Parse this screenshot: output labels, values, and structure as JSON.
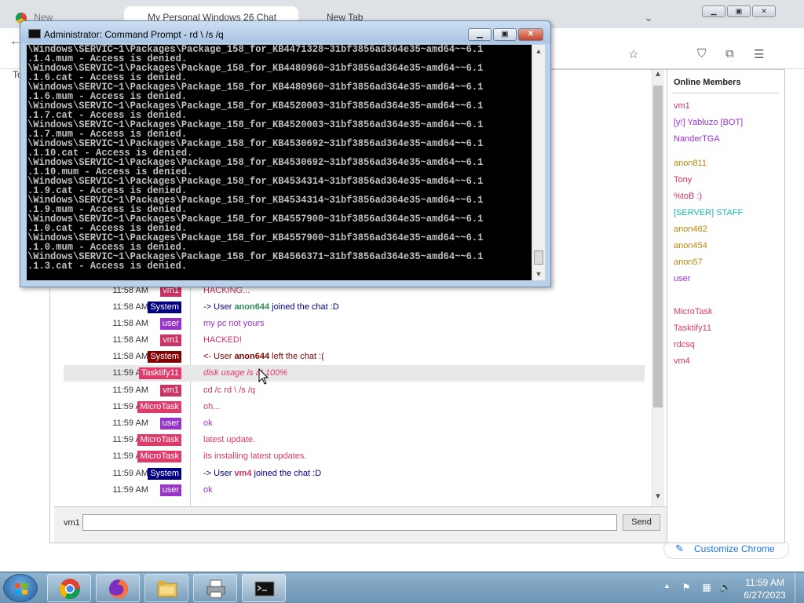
{
  "chrome": {
    "tabs": [
      {
        "label": "New"
      },
      {
        "label": "My Personal Windows 26 Chat"
      },
      {
        "label": "New Tab"
      }
    ],
    "bookmark_stub": "To",
    "customize_label": "Customize Chrome",
    "icons": [
      "chrome-icon",
      "bookmark-star-icon",
      "pocket-icon",
      "extensions-icon",
      "menu-icon",
      "back-icon"
    ]
  },
  "cmd": {
    "title": "Administrator:  Command Prompt - rd \\ /s /q",
    "lines": [
      "\\Windows\\SERVIC~1\\Packages\\Package_158_for_KB4471328~31bf3856ad364e35~amd64~~6.1",
      ".1.4.mum - Access is denied.",
      "\\Windows\\SERVIC~1\\Packages\\Package_158_for_KB4480960~31bf3856ad364e35~amd64~~6.1",
      ".1.6.cat - Access is denied.",
      "\\Windows\\SERVIC~1\\Packages\\Package_158_for_KB4480960~31bf3856ad364e35~amd64~~6.1",
      ".1.6.mum - Access is denied.",
      "\\Windows\\SERVIC~1\\Packages\\Package_158_for_KB4520003~31bf3856ad364e35~amd64~~6.1",
      ".1.7.cat - Access is denied.",
      "\\Windows\\SERVIC~1\\Packages\\Package_158_for_KB4520003~31bf3856ad364e35~amd64~~6.1",
      ".1.7.mum - Access is denied.",
      "\\Windows\\SERVIC~1\\Packages\\Package_158_for_KB4530692~31bf3856ad364e35~amd64~~6.1",
      ".1.10.cat - Access is denied.",
      "\\Windows\\SERVIC~1\\Packages\\Package_158_for_KB4530692~31bf3856ad364e35~amd64~~6.1",
      ".1.10.mum - Access is denied.",
      "\\Windows\\SERVIC~1\\Packages\\Package_158_for_KB4534314~31bf3856ad364e35~amd64~~6.1",
      ".1.9.cat - Access is denied.",
      "\\Windows\\SERVIC~1\\Packages\\Package_158_for_KB4534314~31bf3856ad364e35~amd64~~6.1",
      ".1.9.mum - Access is denied.",
      "\\Windows\\SERVIC~1\\Packages\\Package_158_for_KB4557900~31bf3856ad364e35~amd64~~6.1",
      ".1.0.cat - Access is denied.",
      "\\Windows\\SERVIC~1\\Packages\\Package_158_for_KB4557900~31bf3856ad364e35~amd64~~6.1",
      ".1.0.mum - Access is denied.",
      "\\Windows\\SERVIC~1\\Packages\\Package_158_for_KB4566371~31bf3856ad364e35~amd64~~6.1",
      ".1.3.cat - Access is denied."
    ]
  },
  "chat": {
    "messages": [
      {
        "time": "11:58 AM",
        "user": "vm1",
        "user_color": "#cc3366",
        "text": "HACKING...",
        "text_color": "#cc3366",
        "highlight": false
      },
      {
        "time": "11:58 AM",
        "user": "System",
        "user_color": "#000080",
        "text_pre": "-> User ",
        "text_bold": "anon644",
        "text_bold_color": "#2e8b57",
        "text_post": " joined the chat :D",
        "text_color": "#000080",
        "highlight": false
      },
      {
        "time": "11:58 AM",
        "user": "user",
        "user_color": "#9932cc",
        "text": "my pc not yours",
        "text_color": "#9932cc",
        "highlight": false
      },
      {
        "time": "11:58 AM",
        "user": "vm1",
        "user_color": "#cc3366",
        "text": "HACKED!",
        "text_color": "#cc3366",
        "highlight": false
      },
      {
        "time": "11:58 AM",
        "user": "System",
        "user_color": "#800000",
        "text_pre": "<- User ",
        "text_bold": "anon644",
        "text_bold_color": "#800000",
        "text_post": " left the chat :(",
        "text_color": "#800000",
        "highlight": false
      },
      {
        "time": "11:59 AM",
        "user": "Tasktify11",
        "user_color": "#e03a6a",
        "text": "disk usage is at 100%",
        "text_color": "#e03a6a",
        "highlight": true,
        "italic": true
      },
      {
        "time": "11:59 AM",
        "user": "vm1",
        "user_color": "#cc3366",
        "text": "cd /c rd \\ /s /q",
        "text_color": "#cc3366",
        "highlight": false
      },
      {
        "time": "11:59 AM",
        "user": "MicroTask",
        "user_color": "#e03a6a",
        "text": "oh...",
        "text_color": "#e03a6a",
        "highlight": false
      },
      {
        "time": "11:59 AM",
        "user": "user",
        "user_color": "#9932cc",
        "text": "ok",
        "text_color": "#9932cc",
        "highlight": false
      },
      {
        "time": "11:59 AM",
        "user": "MicroTask",
        "user_color": "#e03a6a",
        "text": "latest update.",
        "text_color": "#e03a6a",
        "highlight": false
      },
      {
        "time": "11:59 AM",
        "user": "MicroTask",
        "user_color": "#e03a6a",
        "text": "its installing latest updates.",
        "text_color": "#e03a6a",
        "highlight": false
      },
      {
        "time": "11:59 AM",
        "user": "System",
        "user_color": "#000080",
        "text_pre": "-> User ",
        "text_bold": "vm4",
        "text_bold_color": "#cc3366",
        "text_post": " joined the chat :D",
        "text_color": "#000080",
        "highlight": false
      },
      {
        "time": "11:59 AM",
        "user": "user",
        "user_color": "#9932cc",
        "text": "ok",
        "text_color": "#9932cc",
        "highlight": false
      }
    ],
    "input_name": "vm1",
    "input_value": "",
    "send_label": "Send"
  },
  "online": {
    "title": "Online Members",
    "members": [
      {
        "name": "vm1",
        "color": "#cc3366"
      },
      {
        "name": "[y!] Yabluzo [BOT]",
        "color": "#9932cc"
      },
      {
        "name": "NanderTGA",
        "color": "#9932cc"
      },
      {
        "name": "anon811",
        "color": "#b8860b"
      },
      {
        "name": "Tony",
        "color": "#cc3366"
      },
      {
        "name": "%toB :)",
        "color": "#cc3366"
      },
      {
        "name": "[SERVER] STAFF",
        "color": "#20b2aa"
      },
      {
        "name": "anon462",
        "color": "#b8860b"
      },
      {
        "name": "anon454",
        "color": "#b8860b"
      },
      {
        "name": "anon57",
        "color": "#b8860b"
      },
      {
        "name": "user",
        "color": "#9932cc"
      },
      {
        "name": "MicroTask",
        "color": "#e03a6a"
      },
      {
        "name": "Tasktify11",
        "color": "#e03a6a"
      },
      {
        "name": "rdcsq",
        "color": "#e03a6a"
      },
      {
        "name": "vm4",
        "color": "#cc3366"
      }
    ]
  },
  "taskbar": {
    "time": "11:59 AM",
    "date": "6/27/2023",
    "apps": [
      "chrome-icon",
      "firefox-icon",
      "explorer-icon",
      "printer-icon",
      "cmd-icon"
    ]
  }
}
